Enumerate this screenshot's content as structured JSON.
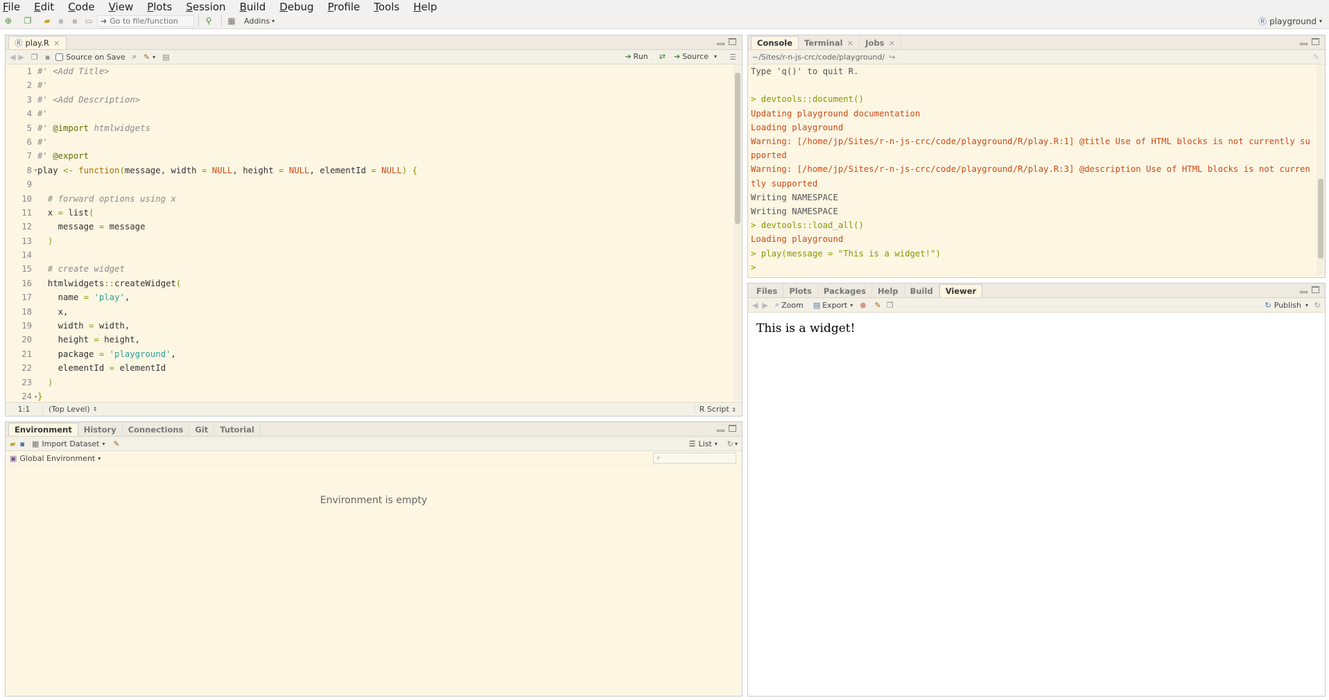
{
  "menu": [
    "File",
    "Edit",
    "Code",
    "View",
    "Plots",
    "Session",
    "Build",
    "Debug",
    "Profile",
    "Tools",
    "Help"
  ],
  "menu_underline": [
    "F",
    "E",
    "C",
    "V",
    "P",
    "S",
    "B",
    "D",
    "P",
    "T",
    "H"
  ],
  "menu_rest": [
    "ile",
    "dit",
    "ode",
    "iew",
    "lots",
    "ession",
    "uild",
    "ebug",
    "rofile",
    "ools",
    "elp"
  ],
  "toolbar": {
    "goto_placeholder": "Go to file/function",
    "addins": "Addins"
  },
  "project": "playground",
  "editor": {
    "tab": "play.R",
    "source_on_save": "Source on Save",
    "run": "Run",
    "source": "Source",
    "position": "1:1",
    "scope": "(Top Level)",
    "filetype": "R Script",
    "lines": [
      "#' <Add Title>",
      "#'",
      "#' <Add Description>",
      "#'",
      "#' @import htmlwidgets",
      "#'",
      "#' @export",
      "play <- function(message, width = NULL, height = NULL, elementId = NULL) {",
      "",
      "  # forward options using x",
      "  x = list(",
      "    message = message",
      "  )",
      "",
      "  # create widget",
      "  htmlwidgets::createWidget(",
      "    name = 'play',",
      "    x,",
      "    width = width,",
      "    height = height,",
      "    package = 'playground',",
      "    elementId = elementId",
      "  )",
      "}"
    ]
  },
  "env": {
    "tabs": [
      "Environment",
      "History",
      "Connections",
      "Git",
      "Tutorial"
    ],
    "import_dataset": "Import Dataset",
    "list": "List",
    "scope": "Global Environment",
    "empty": "Environment is empty"
  },
  "console": {
    "tabs": [
      "Console",
      "Terminal",
      "Jobs"
    ],
    "path": "~/Sites/r-n-js-crc/code/playground/",
    "lines": [
      {
        "t": "out",
        "s": "Type 'q()' to quit R."
      },
      {
        "t": "out",
        "s": " "
      },
      {
        "t": "cmd",
        "s": "> devtools::document()"
      },
      {
        "t": "msg",
        "s": "Updating playground documentation"
      },
      {
        "t": "msg",
        "s": "Loading playground"
      },
      {
        "t": "msg",
        "s": "Warning: [/home/jp/Sites/r-n-js-crc/code/playground/R/play.R:1] @title Use of HTML blocks is not currently supported"
      },
      {
        "t": "msg",
        "s": "Warning: [/home/jp/Sites/r-n-js-crc/code/playground/R/play.R:3] @description Use of HTML blocks is not currently supported"
      },
      {
        "t": "out",
        "s": "Writing NAMESPACE"
      },
      {
        "t": "out",
        "s": "Writing NAMESPACE"
      },
      {
        "t": "cmd",
        "s": "> devtools::load_all()"
      },
      {
        "t": "msg",
        "s": "Loading playground"
      },
      {
        "t": "cmd",
        "s": "> play(message = \"This is a widget!\")"
      },
      {
        "t": "cmd",
        "s": "> "
      }
    ]
  },
  "viewer": {
    "tabs": [
      "Files",
      "Plots",
      "Packages",
      "Help",
      "Build",
      "Viewer"
    ],
    "zoom": "Zoom",
    "export": "Export",
    "publish": "Publish",
    "content": "This is a widget!"
  }
}
